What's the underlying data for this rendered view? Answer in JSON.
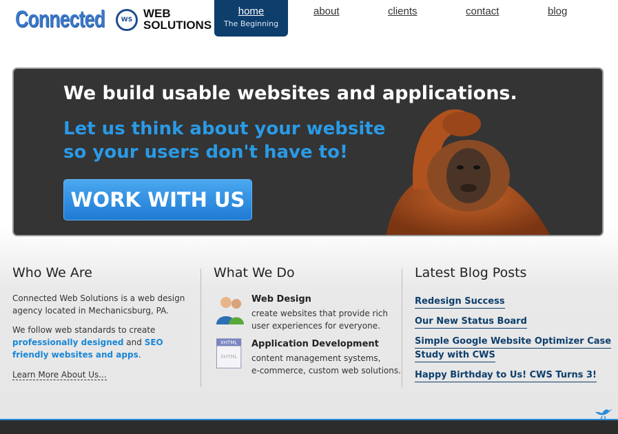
{
  "header": {
    "logo_word": "Connected",
    "logo_badge": "WS",
    "logo_line1": "WEB",
    "logo_line2": "SOLUTIONS",
    "nav": [
      {
        "label": "home",
        "sub": "The Beginning"
      },
      {
        "label": "about"
      },
      {
        "label": "clients"
      },
      {
        "label": "contact"
      },
      {
        "label": "blog"
      }
    ]
  },
  "hero": {
    "title": "We build usable websites and applications.",
    "sub_line1": "Let us think about your website",
    "sub_line2": "so your users don't have to!",
    "cta": "WORK WITH US",
    "image": "orangutan-scratching-head"
  },
  "who": {
    "heading": "Who We Are",
    "p1": "Connected Web Solutions is a web design agency located in Mechanicsburg, PA.",
    "p2_a": "We follow web standards to create ",
    "p2_link1": "professionally designed",
    "p2_b": " and ",
    "p2_link2": "SEO friendly websites and apps",
    "p2_c": ".",
    "learn_more": "Learn More About Us..."
  },
  "what": {
    "heading": "What We Do",
    "services": [
      {
        "title": "Web Design",
        "desc1": "create websites that provide rich",
        "desc2": "user experiences for everyone.",
        "icon": "users-icon"
      },
      {
        "title": "Application Development",
        "desc1": "content management systems,",
        "desc2": "e-commerce, custom web solutions.",
        "icon": "xhtml-document-icon"
      }
    ],
    "xhtml_label": "XHTML"
  },
  "blog": {
    "heading": "Latest Blog Posts",
    "posts": [
      "Redesign Success",
      "Our New Status Board",
      "Simple Google Website Optimizer Case",
      "Study with CWS",
      "Happy Birthday to Us! CWS Turns 3!"
    ]
  },
  "colors": {
    "brand_blue": "#0d3e6c",
    "accent_blue": "#2a9ae6",
    "hero_bg": "#343434"
  }
}
